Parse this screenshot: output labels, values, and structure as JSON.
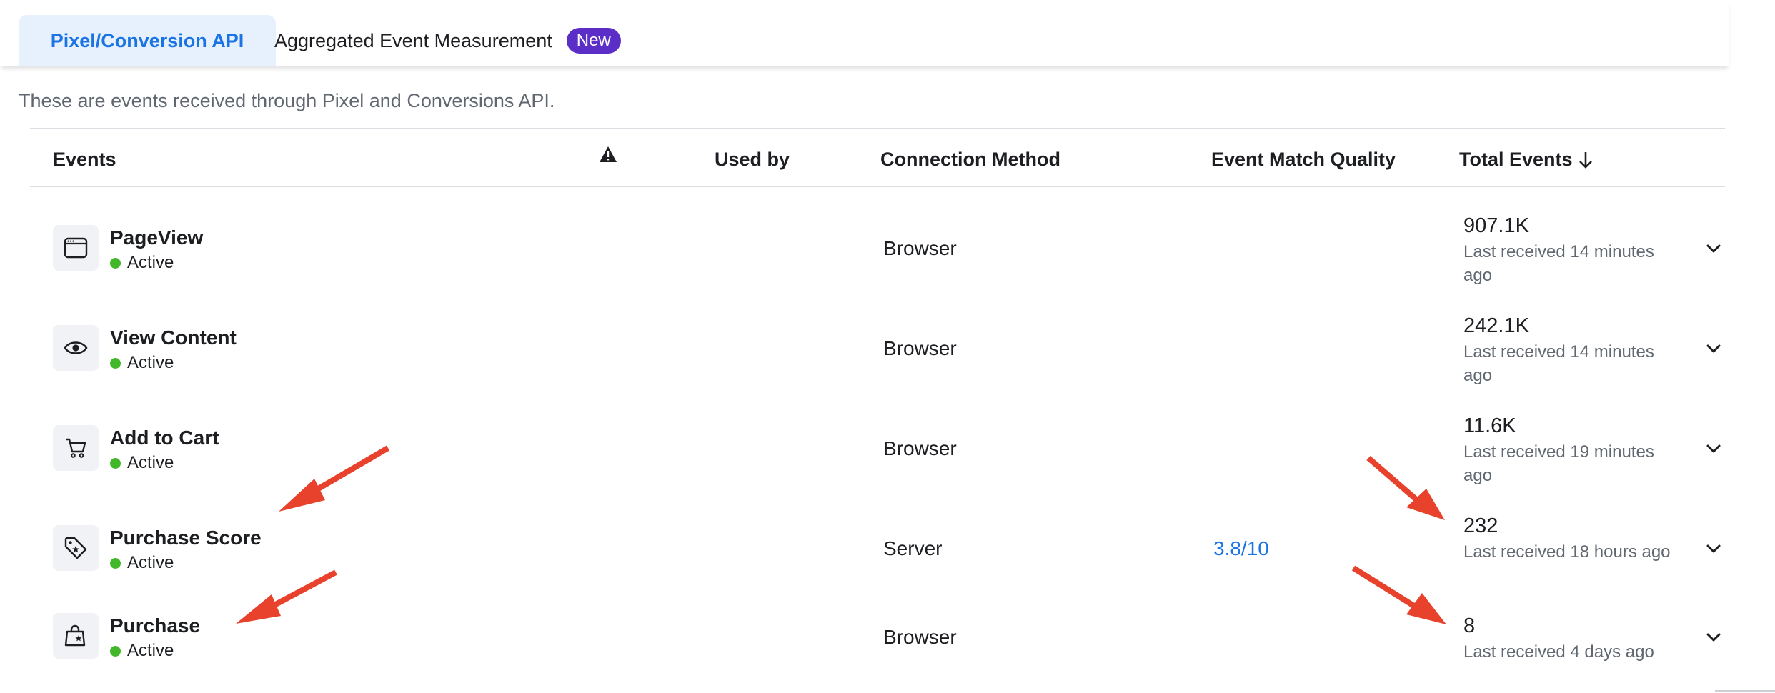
{
  "tabs": {
    "active_label": "Pixel/Conversion API",
    "second_label": "Aggregated Event Measurement",
    "second_badge": "New"
  },
  "subtitle": "These are events received through Pixel and Conversions API.",
  "table": {
    "headers": {
      "events": "Events",
      "used_by": "Used by",
      "connection_method": "Connection Method",
      "event_match_quality": "Event Match Quality",
      "total_events": "Total Events"
    },
    "rows": [
      {
        "icon": "browser-window-icon",
        "name": "PageView",
        "status": "Active",
        "method": "Browser",
        "emq": "",
        "total": "907.1K",
        "last": "Last received 14 minutes ago"
      },
      {
        "icon": "eye-icon",
        "name": "View Content",
        "status": "Active",
        "method": "Browser",
        "emq": "",
        "total": "242.1K",
        "last": "Last received 14 minutes ago"
      },
      {
        "icon": "cart-icon",
        "name": "Add to Cart",
        "status": "Active",
        "method": "Browser",
        "emq": "",
        "total": "11.6K",
        "last": "Last received 19 minutes ago"
      },
      {
        "icon": "price-tag-icon",
        "name": "Purchase Score",
        "status": "Active",
        "method": "Server",
        "emq": "3.8/10",
        "total": "232",
        "last": "Last received 18 hours ago"
      },
      {
        "icon": "shopping-bag-icon",
        "name": "Purchase",
        "status": "Active",
        "method": "Browser",
        "emq": "",
        "total": "8",
        "last": "Last received 4 days ago"
      }
    ]
  },
  "colors": {
    "accent": "#1b74e4",
    "badge": "#5b2fc7",
    "active_dot": "#42b72a",
    "annotation_arrow": "#e8412c"
  }
}
